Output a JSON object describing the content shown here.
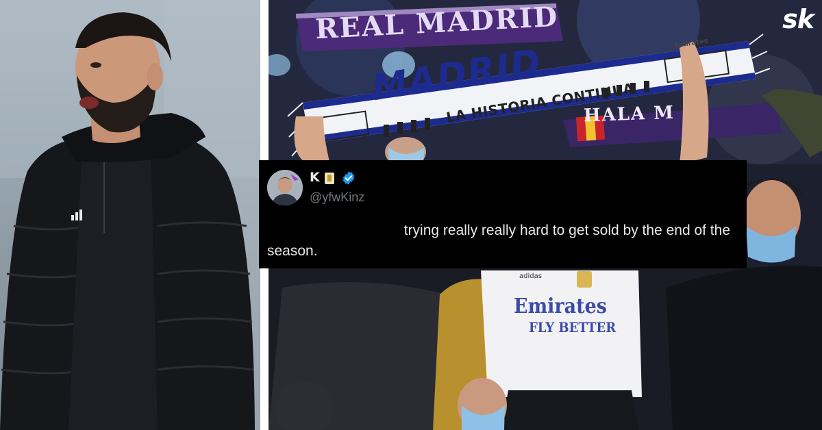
{
  "watermark": {
    "logo_text": "sk"
  },
  "photos": {
    "left": {
      "subject": "coach-portrait",
      "jersey_logo": "adidas"
    },
    "right": {
      "scarf_top_text": "REAL MADRID",
      "scarf_main_text": "MADRID",
      "scarf_sub_text": "LA HISTORIA CONTINUA",
      "scarf_sponsor_text": "Emirates",
      "scarf_third_text": "HALA M",
      "jersey_brand": "adidas",
      "jersey_sponsor_line1": "Emirates",
      "jersey_sponsor_line2": "FLY BETTER"
    }
  },
  "tweet": {
    "display_name": "K",
    "name_emoji_icon": "sticker-emoji-icon",
    "verified_icon": "verified-badge-icon",
    "handle": "@yfwKinz",
    "text_line1": "trying really really hard to get sold by the end of the",
    "text_line2": "season."
  },
  "colors": {
    "tweet_bg": "#000000",
    "tweet_text": "#e7e9ea",
    "handle_text": "#71767b",
    "verified_blue": "#1d9bf0",
    "madrid_blue": "#1d2b8f",
    "purple_scarf": "#4b2a7a"
  }
}
